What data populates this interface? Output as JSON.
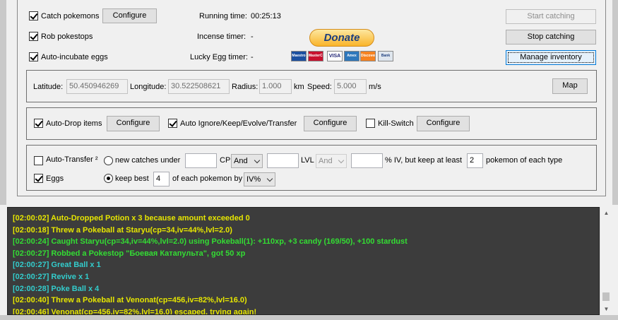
{
  "top": {
    "catch_pokemons": "Catch pokemons",
    "rob_pokestops": "Rob pokestops",
    "auto_incubate": "Auto-incubate eggs",
    "configure": "Configure",
    "running_label": "Running time:",
    "running_value": "00:25:13",
    "incense_label": "Incense timer:",
    "incense_value": "-",
    "lucky_label": "Lucky Egg timer:",
    "lucky_value": "-",
    "donate": "Donate",
    "start_catching": "Start catching",
    "stop_catching": "Stop catching",
    "manage_inventory": "Manage inventory"
  },
  "location": {
    "latitude_label": "Latitude:",
    "latitude": "50.450946269",
    "longitude_label": "Longitude:",
    "longitude": "30.522508621",
    "radius_label": "Radius:",
    "radius": "1.000",
    "radius_unit": "km",
    "speed_label": "Speed:",
    "speed": "5.000",
    "speed_unit": "m/s",
    "map": "Map"
  },
  "items": {
    "auto_drop": "Auto-Drop items",
    "auto_ignore": "Auto Ignore/Keep/Evolve/Transfer",
    "kill_switch": "Kill-Switch",
    "configure": "Configure"
  },
  "transfer": {
    "auto_transfer": "Auto-Transfer ²",
    "new_catches": "new catches under",
    "cp_label": "CP",
    "and1": "And",
    "lvl_label": "LVL",
    "and2": "And",
    "iv_label": "% IV, but keep at least",
    "keep_count": "2",
    "of_each_type": "pokemon of each type",
    "eggs": "Eggs",
    "keep_best": "keep best",
    "keep_best_count": "4",
    "of_each_by": "of each pokemon by",
    "sort_by": "IV%"
  },
  "payment_icons": [
    "Maestro",
    "MasterCard",
    "VISA",
    "Amex",
    "Discover",
    "Bank"
  ],
  "log": [
    {
      "text": "[02:00:02] Auto-Dropped Potion x 3 because amount exceeded 0",
      "color": "#e6e600"
    },
    {
      "text": "[02:00:18] Threw a Pokeball at Staryu(cp=34,iv=44%,lvl=2.0)",
      "color": "#e6e600"
    },
    {
      "text": "[02:00:24] Caught Staryu(cp=34,iv=44%,lvl=2.0) using Pokeball(1): +110xp, +3 candy (169/50), +100 stardust",
      "color": "#33dd33"
    },
    {
      "text": "[02:00:27] Robbed a Pokestop \"Боевая Катапульта\", got 50 xp",
      "color": "#33dd33"
    },
    {
      "text": "[02:00:27]      Great Ball x 1",
      "color": "#33cccc"
    },
    {
      "text": "[02:00:27]      Revive x 1",
      "color": "#33cccc"
    },
    {
      "text": "[02:00:28]      Poke Ball x 4",
      "color": "#33cccc"
    },
    {
      "text": "[02:00:40] Threw a Pokeball at Venonat(cp=456,iv=82%,lvl=16.0)",
      "color": "#e6e600"
    },
    {
      "text": "[02:00:46] Venonat(cp=456,iv=82%,lvl=16.0) escaped, trying again!",
      "color": "#e6e600"
    }
  ]
}
